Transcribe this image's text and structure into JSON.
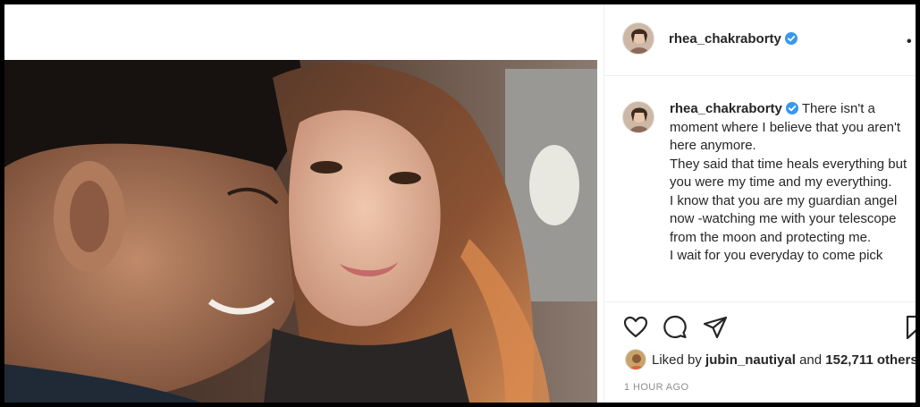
{
  "post": {
    "username": "rhea_chakraborty",
    "verified": true,
    "more_icon": "more-options-icon",
    "caption_lines": [
      "There isn't a moment where I believe that you aren't here anymore.",
      "They said that time heals everything but you were my time and my everything.",
      "I know that you are my guardian angel now -watching me with your telescope from the moon and protecting me.",
      "I wait for you everyday to come pick"
    ],
    "likes": {
      "prefix": "Liked by",
      "user": "jubin_nautiyal",
      "joiner": "and",
      "others": "152,711 others"
    },
    "timestamp": "1 HOUR AGO",
    "action_icons": [
      "heart-icon",
      "comment-icon",
      "share-icon",
      "bookmark-icon"
    ]
  },
  "colors": {
    "verified_blue": "#3897f0",
    "text": "#262626",
    "muted": "#8e8e8e"
  }
}
